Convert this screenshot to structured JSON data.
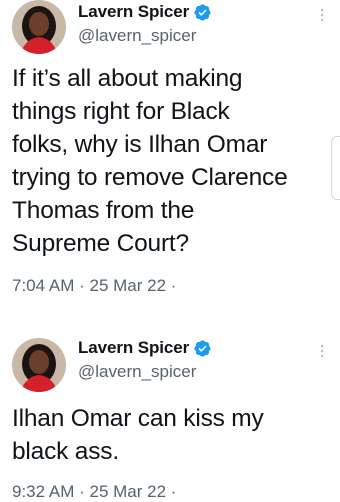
{
  "colors": {
    "text": "#0f1419",
    "secondary": "#536471",
    "verified": "#1d9bf0"
  },
  "tweets": [
    {
      "author": {
        "name": "Lavern Spicer",
        "handle": "@lavern_spicer",
        "verified_icon": "verified-badge-icon",
        "avatar": "profile-photo"
      },
      "text": "If it’s all about making\nthings right for Black\nfolks, why is Ilhan Omar\ntrying to remove Clarence\nThomas from the\nSupreme Court?",
      "time": "7:04 AM",
      "separator": "·",
      "date": "25 Mar 22",
      "trailing": "·",
      "more_icon": "more-options-icon"
    },
    {
      "author": {
        "name": "Lavern Spicer",
        "handle": "@lavern_spicer",
        "verified_icon": "verified-badge-icon",
        "avatar": "profile-photo"
      },
      "text": "Ilhan Omar can kiss my\nblack ass.",
      "time": "9:32 AM",
      "separator": "·",
      "date": "25 Mar 22",
      "trailing": "·",
      "more_icon": "more-options-icon"
    }
  ]
}
